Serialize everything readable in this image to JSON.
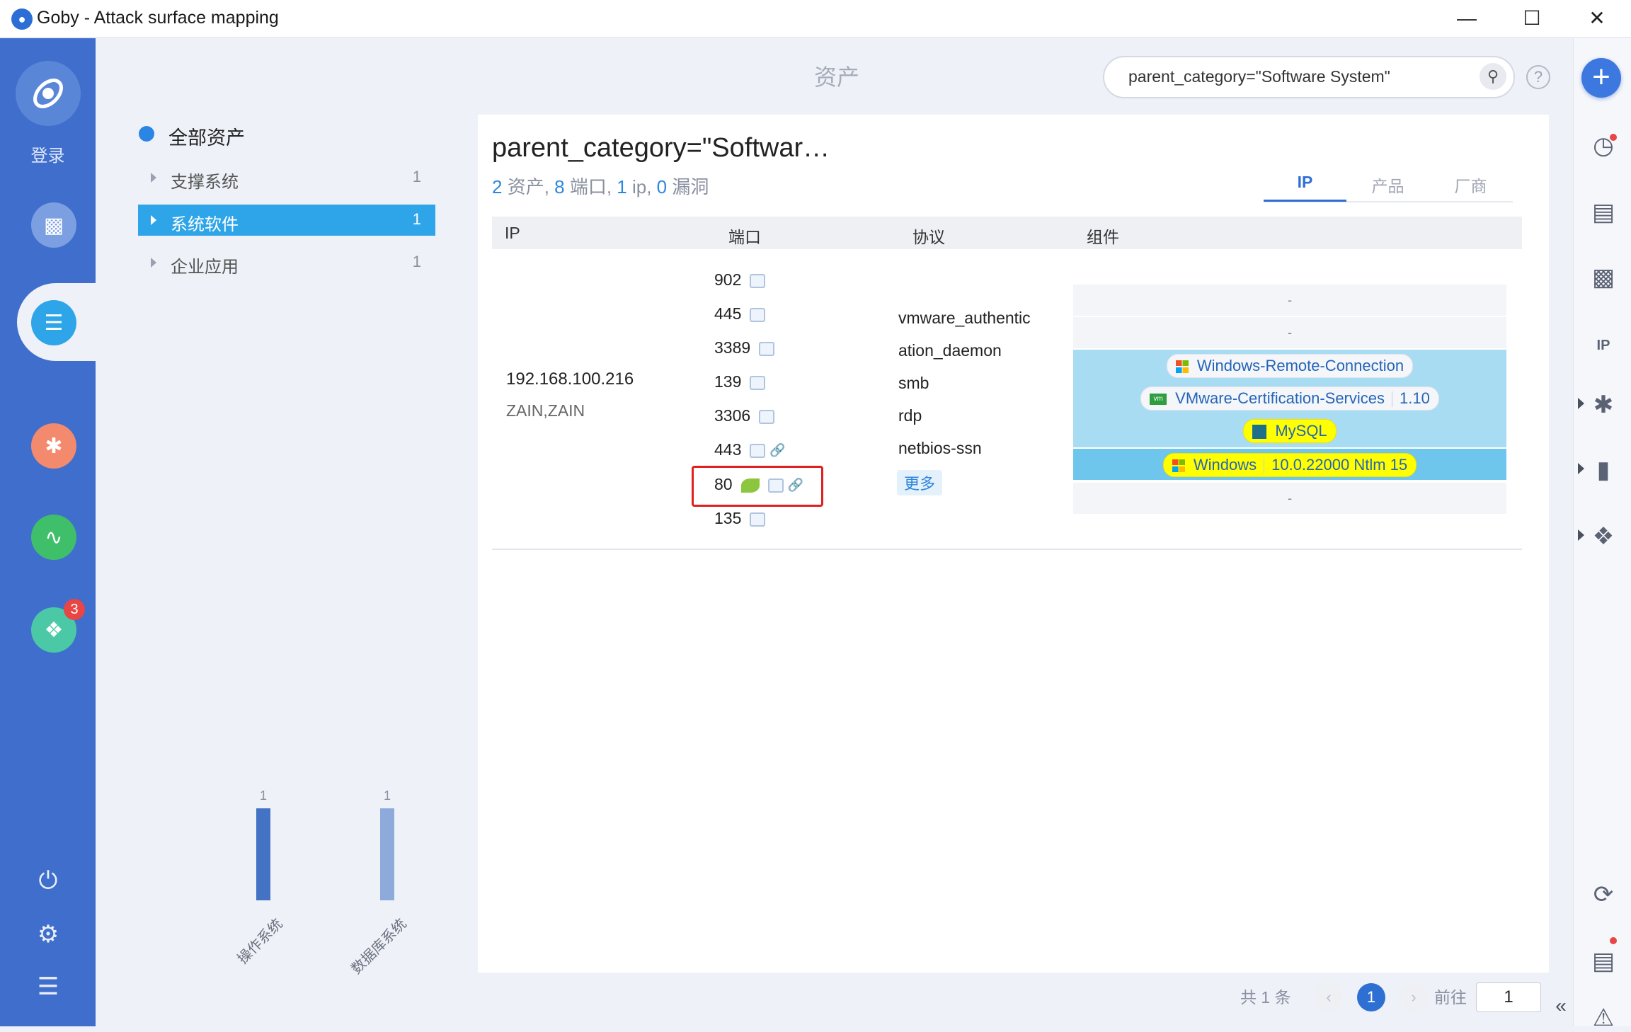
{
  "window": {
    "title": "Goby - Attack surface mapping"
  },
  "left_nav": {
    "login_label": "登录",
    "plugin_badge": "3"
  },
  "header": {
    "page_title": "资产",
    "search_value": "parent_category=\"Software System\""
  },
  "tree": {
    "root_label": "全部资产",
    "items": [
      {
        "label": "支撑系统",
        "count": "1"
      },
      {
        "label": "系统软件",
        "count": "1"
      },
      {
        "label": "企业应用",
        "count": "1"
      }
    ]
  },
  "chart_data": {
    "type": "bar",
    "categories": [
      "操作系统",
      "数据库系统"
    ],
    "values": [
      1,
      1
    ],
    "colors": [
      "#4472c4",
      "#8eaadb"
    ]
  },
  "panel": {
    "title": "parent_category=\"Softwar…",
    "stats": {
      "assets": "2",
      "assets_label": " 资产, ",
      "ports": "8",
      "ports_label": " 端口, ",
      "ips": "1",
      "ips_label": " ip, ",
      "vulns": "0",
      "vulns_label": " 漏洞"
    },
    "tabs": [
      "IP",
      "产品",
      "厂商"
    ]
  },
  "table": {
    "headers": [
      "IP",
      "端口",
      "协议",
      "组件"
    ],
    "ip": "192.168.100.216",
    "hostname": "ZAIN,ZAIN",
    "ports": [
      "902",
      "445",
      "3389",
      "139",
      "3306",
      "443",
      "80",
      "135"
    ],
    "protocols": [
      "vmware_authentic",
      "ation_daemon",
      "smb",
      "rdp",
      "netbios-ssn"
    ],
    "more_label": "更多",
    "components": {
      "dash": "-",
      "rdp": "Windows-Remote-Connection",
      "vmware_name": "VMware-Certification-Services",
      "vmware_version": "1.10",
      "mysql": "MySQL",
      "windows_name": "Windows",
      "windows_version": "10.0.22000 Ntlm 15"
    }
  },
  "pagination": {
    "total": "共 1 条",
    "current": "1",
    "goto_label": "前往",
    "goto_value": "1"
  },
  "colors": {
    "nav_blue": "#3f6ecc",
    "accent": "#2ea5e8",
    "highlight_row": "#a8dcf2"
  }
}
